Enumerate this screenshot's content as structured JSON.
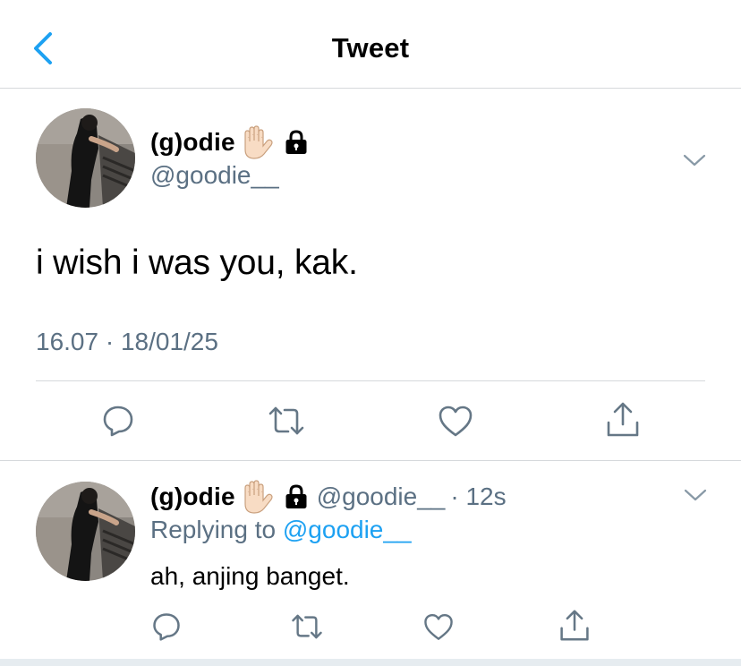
{
  "header": {
    "title": "Tweet"
  },
  "main_tweet": {
    "display_name": "(g)odie",
    "emoji": "raised-hand-light-skin-tone",
    "lock": "lock-icon",
    "handle": "@goodie__",
    "text": "i wish i was you, kak.",
    "timestamp": "16.07 · 18/01/25"
  },
  "reply_tweet": {
    "display_name": "(g)odie",
    "handle": "@goodie__",
    "time_ago": "· 12s",
    "replying_prefix": "Replying to ",
    "replying_to": "@goodie__",
    "text": "ah, anjing banget."
  },
  "colors": {
    "secondary_text": "#5b7083",
    "link": "#1da1f2",
    "icon": "#657786",
    "back_arrow": "#1da1f2",
    "divider": "#d6d9dc"
  }
}
